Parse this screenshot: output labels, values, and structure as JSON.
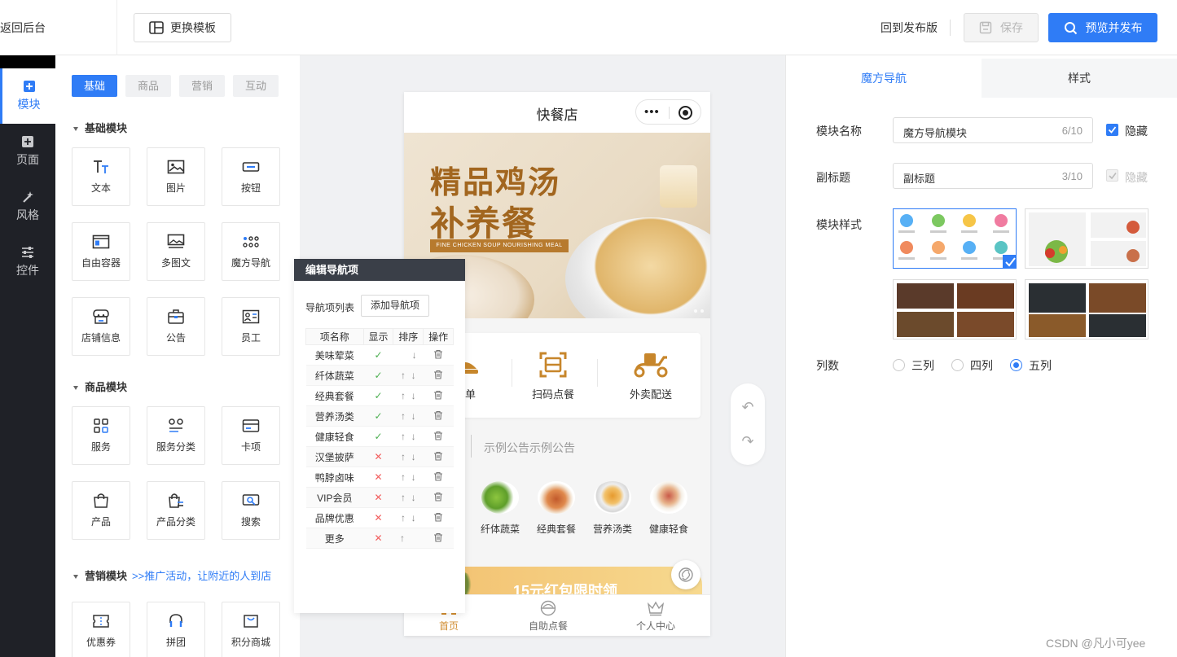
{
  "topbar": {
    "back_label": "返回后台",
    "template_label": "更换模板",
    "return_label": "回到发布版",
    "save_label": "保存",
    "publish_label": "预览并发布"
  },
  "sidebar": {
    "items": [
      {
        "label": "模块",
        "icon": "plus-square-icon"
      },
      {
        "label": "页面",
        "icon": "plus-square-icon"
      },
      {
        "label": "风格",
        "icon": "magic-wand-icon"
      },
      {
        "label": "控件",
        "icon": "sliders-icon"
      }
    ]
  },
  "components": {
    "tabs": [
      "基础",
      "商品",
      "营销",
      "互动"
    ],
    "basic_title": "基础模块",
    "basic": [
      "文本",
      "图片",
      "按钮",
      "自由容器",
      "多图文",
      "魔方导航",
      "店铺信息",
      "公告",
      "员工"
    ],
    "goods_title": "商品模块",
    "goods": [
      "服务",
      "服务分类",
      "卡项",
      "产品",
      "产品分类",
      "搜索"
    ],
    "marketing_title": "营销模块",
    "marketing_sub": ">>推广活动，让附近的人到店",
    "marketing": [
      "优惠券",
      "拼团",
      "积分商城"
    ]
  },
  "phone": {
    "title": "快餐店",
    "banner_line1": "精品鸡汤",
    "banner_line2": "补养餐",
    "banner_sub": "FINE CHICKEN SOUP NOURISHING MEAL",
    "nav": [
      "买单",
      "扫码点餐",
      "外卖配送"
    ],
    "notice": "示例公告示例公告",
    "foods": [
      "纤体蔬菜",
      "经典套餐",
      "营养汤类",
      "健康轻食"
    ],
    "promo": "15元红包限时领",
    "tabs": [
      "首页",
      "自助点餐",
      "个人中心"
    ]
  },
  "editnav": {
    "title": "编辑导航项",
    "list_label": "导航项列表",
    "add_label": "添加导航项",
    "headers": [
      "项名称",
      "显示",
      "排序",
      "操作"
    ],
    "rows": [
      {
        "name": "美味荤菜",
        "show": true,
        "up": false,
        "down": true
      },
      {
        "name": "纤体蔬菜",
        "show": true,
        "up": true,
        "down": true
      },
      {
        "name": "经典套餐",
        "show": true,
        "up": true,
        "down": true
      },
      {
        "name": "营养汤类",
        "show": true,
        "up": true,
        "down": true
      },
      {
        "name": "健康轻食",
        "show": true,
        "up": true,
        "down": true
      },
      {
        "name": "汉堡披萨",
        "show": false,
        "up": true,
        "down": true
      },
      {
        "name": "鸭脖卤味",
        "show": false,
        "up": true,
        "down": true
      },
      {
        "name": "VIP会员",
        "show": false,
        "up": true,
        "down": true
      },
      {
        "name": "品牌优惠",
        "show": false,
        "up": true,
        "down": true
      },
      {
        "name": "更多",
        "show": false,
        "up": true,
        "down": false
      }
    ]
  },
  "settings": {
    "tabs": [
      "魔方导航",
      "样式"
    ],
    "name_label": "模块名称",
    "name_value": "魔方导航模块",
    "name_count": "6/10",
    "hide_label": "隐藏",
    "subtitle_label": "副标题",
    "subtitle_value": "副标题",
    "subtitle_count": "3/10",
    "hide_label2": "隐藏",
    "style_label": "模块样式",
    "columns_label": "列数",
    "columns": [
      "三列",
      "四列",
      "五列"
    ],
    "columns_selected": "五列"
  },
  "watermark": "CSDN @凡小可yee",
  "colors": {
    "accent": "#2f7cf6",
    "sidebar": "#1f2127",
    "gold": "#d18e32"
  }
}
